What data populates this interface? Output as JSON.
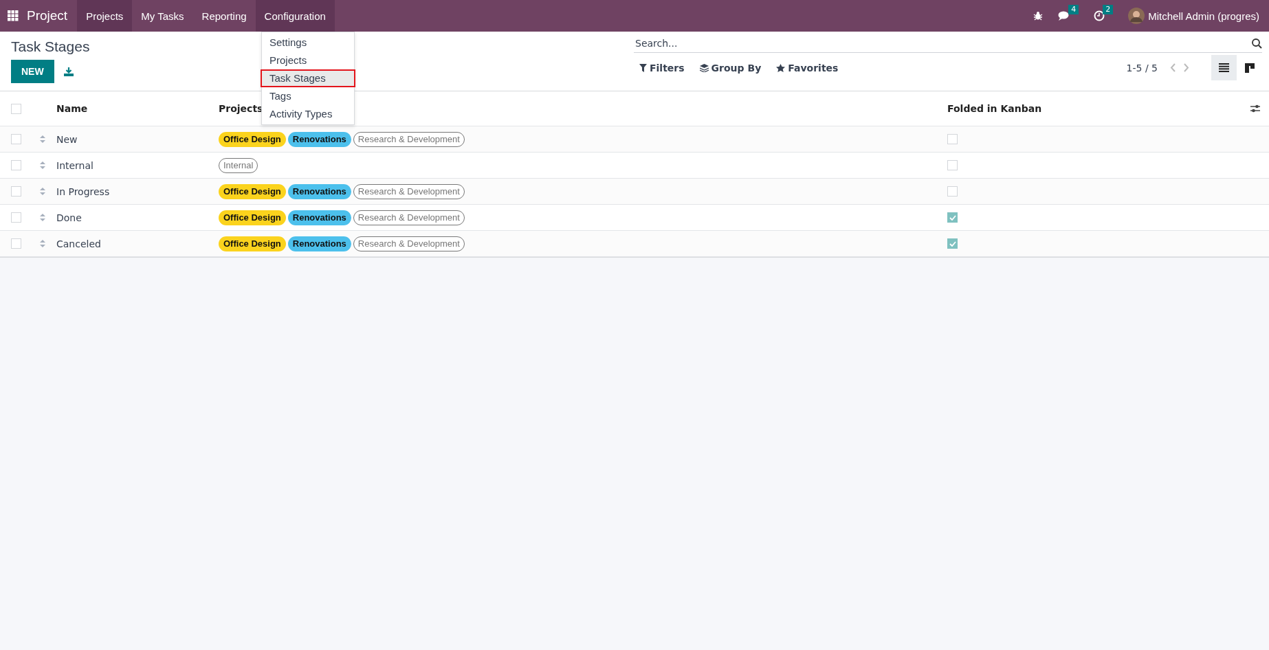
{
  "navbar": {
    "app_name": "Project",
    "menu": [
      {
        "label": "Projects",
        "selected": true
      },
      {
        "label": "My Tasks",
        "selected": false
      },
      {
        "label": "Reporting",
        "selected": false
      },
      {
        "label": "Configuration",
        "selected": true
      }
    ],
    "messages_count": "4",
    "activities_count": "2",
    "user": "Mitchell Admin (progres)"
  },
  "dropdown": {
    "items": [
      {
        "label": "Settings",
        "selected": false
      },
      {
        "label": "Projects",
        "selected": false
      },
      {
        "label": "Task Stages",
        "selected": true
      },
      {
        "label": "Tags",
        "selected": false
      },
      {
        "label": "Activity Types",
        "selected": false
      }
    ]
  },
  "control_panel": {
    "title": "Task Stages",
    "new_button": "NEW",
    "search": {
      "placeholder": "Search..."
    },
    "filters": [
      "Filters",
      "Group By",
      "Favorites"
    ],
    "pager": "1-5 / 5",
    "views": [
      {
        "kind": "list",
        "selected": true
      },
      {
        "kind": "kanban",
        "selected": false
      }
    ]
  },
  "table": {
    "all_selected": false,
    "columns": [
      "Name",
      "Projects",
      "Folded in Kanban"
    ],
    "rows": [
      {
        "selected": false,
        "name": "New",
        "folded": false,
        "projects": [
          {
            "label": "Office Design",
            "kind": "filled",
            "color": "#fbd31d"
          },
          {
            "label": "Renovations",
            "kind": "filled",
            "color": "#4cc0ec"
          },
          {
            "label": "Research & Development",
            "kind": "outline",
            "color": "#777777"
          }
        ]
      },
      {
        "selected": false,
        "name": "Internal",
        "folded": false,
        "projects": [
          {
            "label": "Internal",
            "kind": "outline",
            "color": "#777777"
          }
        ]
      },
      {
        "selected": false,
        "name": "In Progress",
        "folded": false,
        "projects": [
          {
            "label": "Office Design",
            "kind": "filled",
            "color": "#fbd31d"
          },
          {
            "label": "Renovations",
            "kind": "filled",
            "color": "#4cc0ec"
          },
          {
            "label": "Research & Development",
            "kind": "outline",
            "color": "#777777"
          }
        ]
      },
      {
        "selected": false,
        "name": "Done",
        "folded": true,
        "projects": [
          {
            "label": "Office Design",
            "kind": "filled",
            "color": "#fbd31d"
          },
          {
            "label": "Renovations",
            "kind": "filled",
            "color": "#4cc0ec"
          },
          {
            "label": "Research & Development",
            "kind": "outline",
            "color": "#777777"
          }
        ]
      },
      {
        "selected": false,
        "name": "Canceled",
        "folded": true,
        "projects": [
          {
            "label": "Office Design",
            "kind": "filled",
            "color": "#fbd31d"
          },
          {
            "label": "Renovations",
            "kind": "filled",
            "color": "#4cc0ec"
          },
          {
            "label": "Research & Development",
            "kind": "outline",
            "color": "#777777"
          }
        ]
      }
    ]
  }
}
